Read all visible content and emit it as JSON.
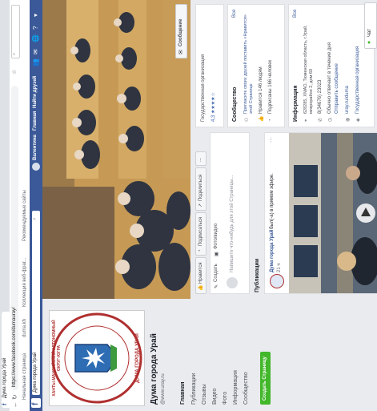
{
  "browser": {
    "tab_title": "Дума города Урай",
    "url": "https://www.facebook.com/dumauray/",
    "bookmarks": [
      "Начальная страница",
      "duma.kh",
      "Коллекция веб-фраг...",
      "Рекомендуемые сайты"
    ]
  },
  "fb_header": {
    "page_name": "Дума города Урай",
    "user": "Валентина",
    "home": "Главная",
    "find_friends": "Найти друзей",
    "search_placeholder": "Поиск"
  },
  "sidebar": {
    "title": "Дума города Урай",
    "handle": "@www.uray.ru",
    "items": [
      "Главная",
      "Публикации",
      "Отзывы",
      "Видео",
      "Фото",
      "Информация",
      "Сообщество"
    ],
    "create_button": "Создать Страницу"
  },
  "logo": {
    "top_text": "ХАНТЫ-МАНСИЙСКИЙ АВТОНОМНЫЙ ОКРУГ-ЮГРА",
    "bottom_text": "ДУМА ГОРОДА УРАЙ"
  },
  "cover": {
    "message_button": "Сообщение"
  },
  "actions": {
    "like": "Нравится",
    "follow": "Подписаться",
    "share": "Поделиться",
    "more": "..."
  },
  "composer": {
    "tabs": [
      "Создать",
      "Фото/видео"
    ],
    "placeholder": "Напишите что-нибудь для этой Страницы..."
  },
  "publications": {
    "heading": "Публикации",
    "post_author": "Дума города Урай",
    "post_text": "был(-а) в прямом эфире.",
    "post_time": "21 ч"
  },
  "about": {
    "category": "Государственная организация",
    "rating": "4,3 ★★★★☆"
  },
  "community": {
    "heading": "Сообщество",
    "see_all": "Все",
    "lines": [
      "Пригласите своих друзей поставить «Нравится» этой Странице",
      "Нравится 146 людям",
      "Подписаны 166 человек"
    ]
  },
  "info": {
    "heading": "Информация",
    "see_all": "Все",
    "lines": [
      "628285, ХМАО, Тюменская область, г.Урай, микрорайон 2, дом 60",
      "8(34676) 23023",
      "Обычно отвечает в течение дня",
      "Отправить сообщение",
      "uray.ru/duma",
      "Государственная организация"
    ]
  },
  "chat": {
    "label": "Чат"
  },
  "colors": {
    "fb_blue": "#3b5998",
    "create_green": "#42b72a",
    "cover_wood": "#c9a05a"
  }
}
